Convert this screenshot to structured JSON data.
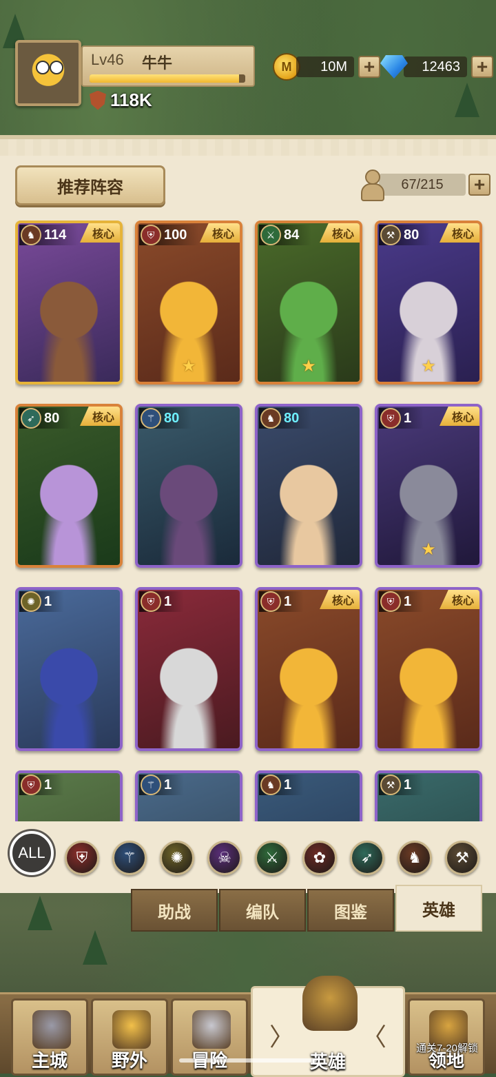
{
  "player": {
    "level": "Lv46",
    "name": "牛牛",
    "xp_fraction": 0.96,
    "power": "118K"
  },
  "resources": {
    "coin_icon_letter": "M",
    "coins": "10M",
    "gems": "12463"
  },
  "panel": {
    "recommend_button": "推荐阵容",
    "capacity": "67/215"
  },
  "core_badge": "核心",
  "heroes": [
    {
      "level": "114",
      "core": true,
      "frame": "gold",
      "class": "orc-icon",
      "star": false
    },
    {
      "level": "100",
      "core": true,
      "frame": "orange",
      "class": "shield-icon",
      "star": true
    },
    {
      "level": "84",
      "core": true,
      "frame": "orange",
      "class": "swords-icon",
      "star": true
    },
    {
      "level": "80",
      "core": true,
      "frame": "orange",
      "class": "hammer-icon",
      "star": true
    },
    {
      "level": "80",
      "core": true,
      "frame": "orange",
      "class": "bow-icon",
      "star": false
    },
    {
      "level": "80",
      "core": false,
      "frame": "purple",
      "class": "staff-icon",
      "star": false
    },
    {
      "level": "80",
      "core": false,
      "frame": "purple",
      "class": "orc-icon",
      "star": false
    },
    {
      "level": "1",
      "core": true,
      "frame": "purple",
      "class": "shield-icon",
      "star": true
    },
    {
      "level": "1",
      "core": false,
      "frame": "purple",
      "class": "crest-icon",
      "star": false
    },
    {
      "level": "1",
      "core": false,
      "frame": "purple",
      "class": "shield-icon",
      "star": false
    },
    {
      "level": "1",
      "core": true,
      "frame": "purple",
      "class": "shield-icon",
      "star": false
    },
    {
      "level": "1",
      "core": true,
      "frame": "purple",
      "class": "shield-icon",
      "star": false
    },
    {
      "level": "1",
      "core": false,
      "frame": "purple",
      "class": "shield-icon",
      "star": false
    },
    {
      "level": "1",
      "core": false,
      "frame": "purple",
      "class": "staff-icon",
      "star": false
    },
    {
      "level": "1",
      "core": false,
      "frame": "purple",
      "class": "orc-icon",
      "star": false
    },
    {
      "level": "1",
      "core": false,
      "frame": "purple",
      "class": "hammer-icon",
      "star": false
    }
  ],
  "filters": {
    "all_label": "ALL",
    "items": [
      "shield-icon",
      "staff-icon",
      "crest-icon",
      "skull-icon",
      "swords-icon",
      "paw-icon",
      "bow-icon",
      "orc-icon",
      "hammer-icon"
    ]
  },
  "subtabs": [
    "助战",
    "编队",
    "图鉴",
    "英雄"
  ],
  "nav": {
    "items": [
      "主城",
      "野外",
      "冒险",
      "英雄",
      "领地"
    ],
    "lock_text": "通关7-20解锁"
  }
}
